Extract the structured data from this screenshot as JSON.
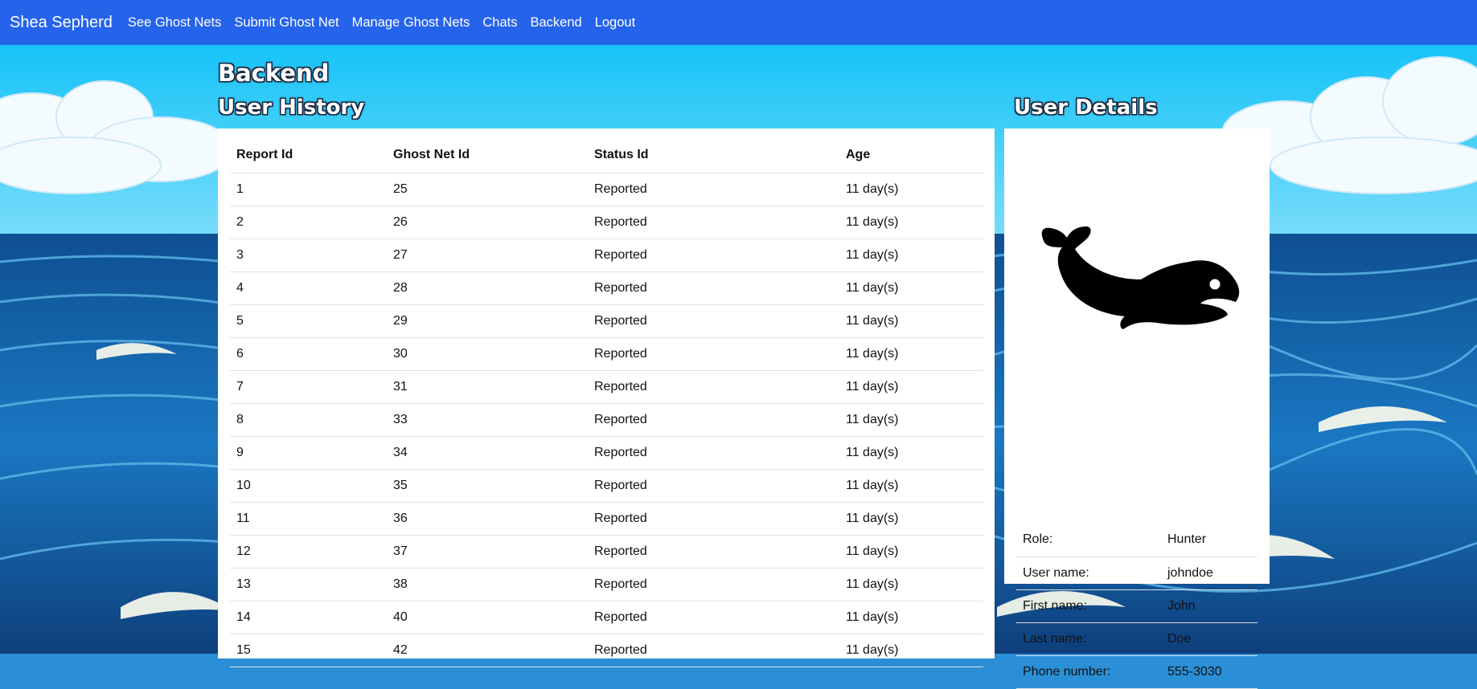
{
  "navbar": {
    "brand": "Shea Sepherd",
    "links": [
      "See Ghost Nets",
      "Submit Ghost Net",
      "Manage Ghost Nets",
      "Chats",
      "Backend",
      "Logout"
    ]
  },
  "page": {
    "title": "Backend",
    "history_title": "User History",
    "details_title": "User Details"
  },
  "history": {
    "columns": [
      "Report Id",
      "Ghost Net Id",
      "Status Id",
      "Age"
    ],
    "rows": [
      [
        "1",
        "25",
        "Reported",
        "11 day(s)"
      ],
      [
        "2",
        "26",
        "Reported",
        "11 day(s)"
      ],
      [
        "3",
        "27",
        "Reported",
        "11 day(s)"
      ],
      [
        "4",
        "28",
        "Reported",
        "11 day(s)"
      ],
      [
        "5",
        "29",
        "Reported",
        "11 day(s)"
      ],
      [
        "6",
        "30",
        "Reported",
        "11 day(s)"
      ],
      [
        "7",
        "31",
        "Reported",
        "11 day(s)"
      ],
      [
        "8",
        "33",
        "Reported",
        "11 day(s)"
      ],
      [
        "9",
        "34",
        "Reported",
        "11 day(s)"
      ],
      [
        "10",
        "35",
        "Reported",
        "11 day(s)"
      ],
      [
        "11",
        "36",
        "Reported",
        "11 day(s)"
      ],
      [
        "12",
        "37",
        "Reported",
        "11 day(s)"
      ],
      [
        "13",
        "38",
        "Reported",
        "11 day(s)"
      ],
      [
        "14",
        "40",
        "Reported",
        "11 day(s)"
      ],
      [
        "15",
        "42",
        "Reported",
        "11 day(s)"
      ]
    ]
  },
  "details": {
    "avatar_icon": "whale-icon",
    "rows": [
      {
        "label": "Role:",
        "value": "Hunter"
      },
      {
        "label": "User name:",
        "value": "johndoe"
      },
      {
        "label": "First name:",
        "value": "John"
      },
      {
        "label": "Last name:",
        "value": "Doe"
      },
      {
        "label": "Phone number:",
        "value": "555-3030"
      }
    ]
  },
  "colors": {
    "navbar": "#2563eb",
    "sky": "#2fc4f5",
    "ocean": "#1466a8",
    "card": "#ffffff"
  }
}
